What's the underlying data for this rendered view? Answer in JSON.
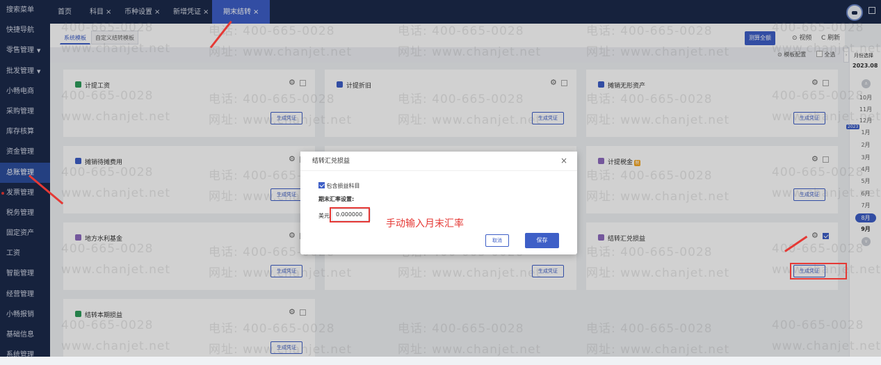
{
  "sidebar": {
    "items": [
      {
        "label": "搜索菜单"
      },
      {
        "label": "快捷导航"
      },
      {
        "label": "零售管理",
        "arrow": "▼"
      },
      {
        "label": "批发管理",
        "arrow": "▼"
      },
      {
        "label": "小畅电商"
      },
      {
        "label": "采购管理"
      },
      {
        "label": "库存核算"
      },
      {
        "label": "资金管理"
      },
      {
        "label": "总账管理"
      },
      {
        "label": "发票管理"
      },
      {
        "label": "税务管理"
      },
      {
        "label": "固定资产"
      },
      {
        "label": "工资"
      },
      {
        "label": "智能管理"
      },
      {
        "label": "经营管理"
      },
      {
        "label": "小畅报销"
      },
      {
        "label": "基础信息"
      },
      {
        "label": "系统管理"
      }
    ]
  },
  "tabs": [
    {
      "label": "首页",
      "close": ""
    },
    {
      "label": "科目",
      "close": "×"
    },
    {
      "label": "币种设置",
      "close": "×"
    },
    {
      "label": "新增凭证",
      "close": "×"
    },
    {
      "label": "期末结转",
      "close": "×"
    }
  ],
  "subtabs": [
    "系统模板",
    "自定义结转模板"
  ],
  "toolbar": {
    "batch": "测算全额",
    "video": "⊙ 视频",
    "refresh": "C 刷新",
    "template_config": "⊙ 模板配置",
    "select_all": "全选"
  },
  "month_nav": {
    "title": "月份选择",
    "year": "2023.08",
    "year_badge": "2023",
    "months": [
      "10月",
      "11月",
      "12月",
      "1月",
      "2月",
      "3月",
      "4月",
      "5月",
      "6月",
      "7月",
      "8月",
      "9月"
    ],
    "current": "8月",
    "up": "∧",
    "down": "∨"
  },
  "cards": [
    {
      "title": "计提工资",
      "badge": "",
      "icon_color": "#2e9d5b",
      "checked": false,
      "button": "生成凭证"
    },
    {
      "title": "计提折旧",
      "badge": "",
      "icon_color": "#3e5fc7",
      "checked": false,
      "button": "生成凭证"
    },
    {
      "title": "摊销无形资产",
      "badge": "",
      "icon_color": "#3e5fc7",
      "checked": false,
      "button": "生成凭证"
    },
    {
      "title": "摊销待摊费用",
      "badge": "",
      "icon_color": "#3e5fc7",
      "checked": false,
      "button": "生成凭证"
    },
    {
      "title": "",
      "badge": "",
      "icon_color": "#3e5fc7",
      "checked": false,
      "button": "生成凭证"
    },
    {
      "title": "计提税金",
      "badge": "税",
      "icon_color": "#8e6bbf",
      "checked": false,
      "button": "生成凭证"
    },
    {
      "title": "地方水利基金",
      "badge": "",
      "icon_color": "#8e6bbf",
      "checked": false,
      "button": "生成凭证"
    },
    {
      "title": "",
      "badge": "",
      "icon_color": "#3e5fc7",
      "checked": false,
      "button": "生成凭证"
    },
    {
      "title": "结转汇兑损益",
      "badge": "",
      "icon_color": "#8e6bbf",
      "checked": true,
      "button": "生成凭证"
    },
    {
      "title": "结转本期损益",
      "badge": "",
      "icon_color": "#2e9d5b",
      "checked": false,
      "button": "生成凭证"
    }
  ],
  "watermark": {
    "phone": "电话: 400-665-0028",
    "site": "网址: www.chanjet.net",
    "phone_short": "400-665-0028",
    "site_short": "www.chanjet.net"
  },
  "dialog": {
    "title": "结转汇兑损益",
    "close": "×",
    "include_label": "包含损益科目",
    "include_checked": true,
    "rate_title": "期末汇率设置:",
    "currency": "美元",
    "rate_value": "0.000000",
    "cancel": "取消",
    "save": "保存"
  },
  "annotation": {
    "text": "手动输入月末汇率",
    "color": "#e53935"
  }
}
